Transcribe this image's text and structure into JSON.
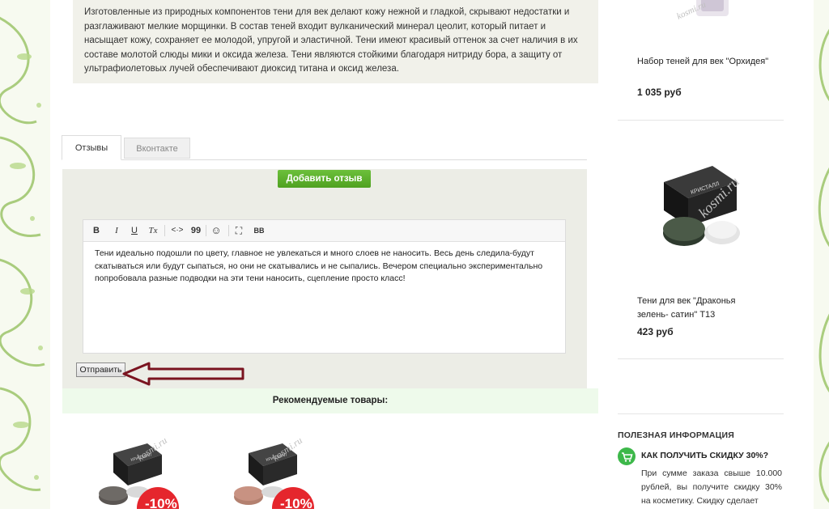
{
  "description": {
    "text": "Изготовленные из природных компонентов тени для век делают кожу нежной и гладкой, скрывают недостатки и разглаживают мелкие морщинки. В состав теней входит вулканический минерал цеолит, который питает и насыщает кожу, сохраняет ее молодой, упругой и эластичной. Тени имеют красивый оттенок за счет наличия в их составе молотой слюды мики и оксида железа. Тени являются стойкими благодаря нитриду бора, а защиту от ультрафиолетовых лучей обеспечивают диоксид титана и оксид железа."
  },
  "tabs": [
    {
      "label": "Отзывы",
      "active": true
    },
    {
      "label": "Вконтакте",
      "active": false
    }
  ],
  "review": {
    "add_button": "Добавить отзыв",
    "toolbar": [
      "B",
      "I",
      "U",
      "Tx",
      "<·>",
      "99",
      "☺",
      "⛶",
      "BB"
    ],
    "text": "Тени идеально подошли по цвету, главное не увлекаться и много слоев не наносить. Весь день следила-будут скатываться или будут сыпаться, но они не скатывались и не сыпались. Вечером специально экспериментально попробовала разные подводки на эти тени наносить, сцепление просто класс!",
    "submit": "Отправить"
  },
  "recommended": {
    "title": "Рекомендуемые товары:",
    "items": [
      {
        "badge": "-10%",
        "box_text": "КРИСТАЛЛ",
        "color": "#5a5552"
      },
      {
        "badge": "-10%",
        "box_text": "КРИСТАЛЛ",
        "color": "#b3806f"
      }
    ]
  },
  "sidebar": {
    "products": [
      {
        "name": "Набор теней для век \"Орхидея\"",
        "price": "1 035 руб"
      },
      {
        "name": "Тени для век \"Драконья зелень- сатин\" Т13",
        "price": "423 руб",
        "box_text": "КРИСТАЛЛ"
      }
    ],
    "info": {
      "heading": "ПОЛЕЗНАЯ ИНФОРМАЦИЯ",
      "title": "КАК ПОЛУЧИТЬ СКИДКУ 30%?",
      "text": "При сумме заказа свыше 10.000 рублей, вы получите скидку 30% на косметику. Скидку сделает"
    }
  },
  "colors": {
    "green_button": "#4fa120",
    "badge_red": "#e5262d",
    "arrow": "#7a1420",
    "cart_icon": "#3db84a"
  }
}
